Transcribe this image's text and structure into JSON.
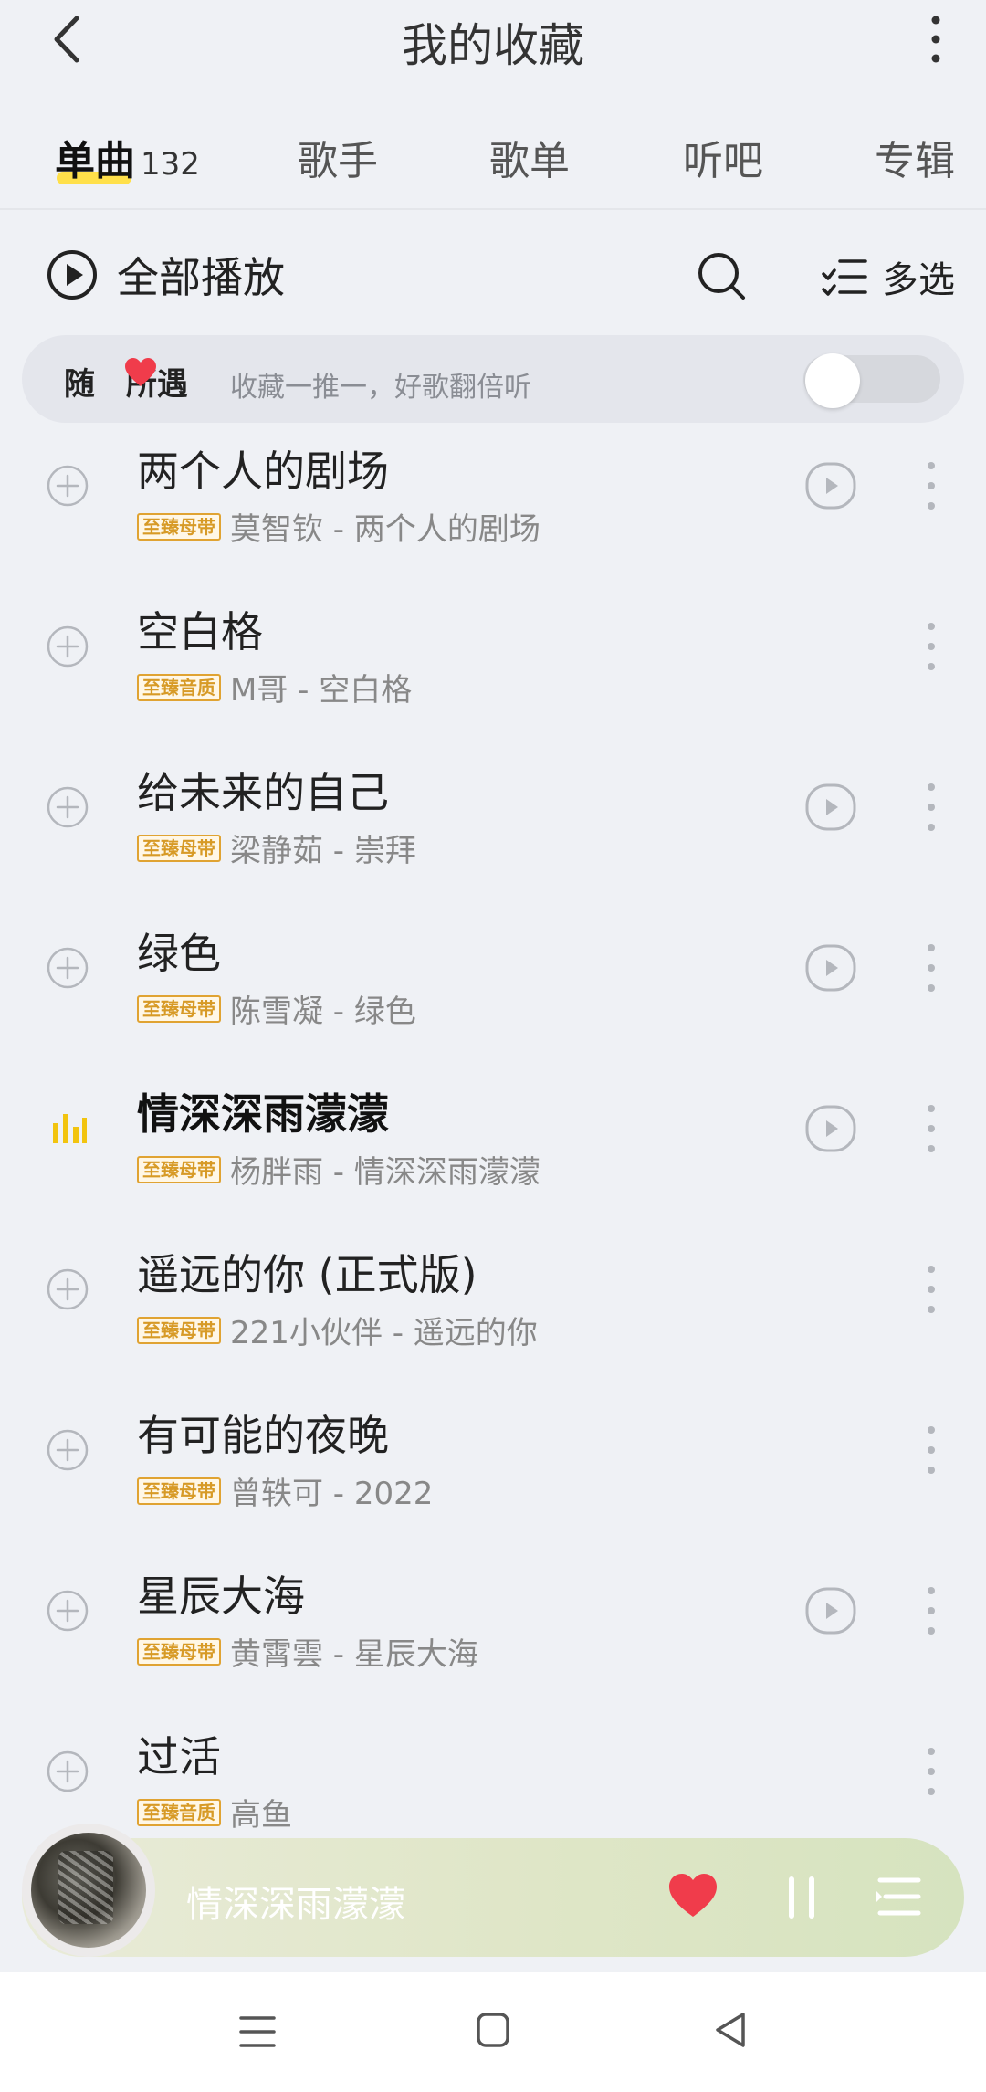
{
  "header": {
    "title": "我的收藏",
    "back_icon": "chevron-left-icon",
    "more_icon": "more-vertical-icon"
  },
  "tabs": [
    {
      "label": "单曲",
      "count": "132",
      "active": true
    },
    {
      "label": "歌手"
    },
    {
      "label": "歌单"
    },
    {
      "label": "听吧"
    },
    {
      "label": "专辑"
    }
  ],
  "actions": {
    "play_all": "全部播放",
    "multi_select": "多选"
  },
  "banner": {
    "title_part1": "随",
    "title_part2": "所遇",
    "subtitle": "收藏一推一，好歌翻倍听",
    "toggle_on": false
  },
  "songs": [
    {
      "title": "两个人的剧场",
      "badge": "至臻母带",
      "meta": "莫智钦 - 两个人的剧场",
      "has_play": true,
      "playing": false
    },
    {
      "title": "空白格",
      "badge": "至臻音质",
      "meta": "M哥 - 空白格",
      "has_play": false,
      "playing": false
    },
    {
      "title": "给未来的自己",
      "badge": "至臻母带",
      "meta": "梁静茹 - 崇拜",
      "has_play": true,
      "playing": false
    },
    {
      "title": "绿色",
      "badge": "至臻母带",
      "meta": "陈雪凝 - 绿色",
      "has_play": true,
      "playing": false
    },
    {
      "title": "情深深雨濛濛",
      "badge": "至臻母带",
      "meta": "杨胖雨 - 情深深雨濛濛",
      "has_play": true,
      "playing": true
    },
    {
      "title": "遥远的你 (正式版)",
      "badge": "至臻母带",
      "meta": "221小伙伴 - 遥远的你",
      "has_play": false,
      "playing": false
    },
    {
      "title": "有可能的夜晚",
      "badge": "至臻母带",
      "meta": "曾轶可 - 2022",
      "has_play": false,
      "playing": false
    },
    {
      "title": "星辰大海",
      "badge": "至臻母带",
      "meta": "黄霄雲 - 星辰大海",
      "has_play": true,
      "playing": false
    },
    {
      "title": "过活",
      "badge": "至臻音质",
      "meta": "高鱼",
      "has_play": false,
      "playing": false
    }
  ],
  "mini_player": {
    "title": "情深深雨濛濛",
    "liked": true
  },
  "colors": {
    "accent_yellow": "#ffe04a",
    "heart_red": "#f03c4b",
    "badge_orange": "#e0a332"
  }
}
